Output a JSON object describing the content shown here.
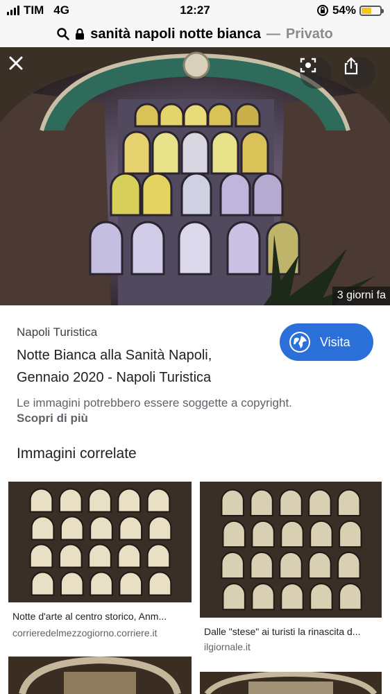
{
  "status_bar": {
    "carrier": "TIM",
    "network": "4G",
    "time": "12:27",
    "battery_percent": "54%",
    "battery_level": 0.54,
    "battery_color": "#f5c518"
  },
  "url_bar": {
    "query": "sanità napoli notte bianca",
    "separator": "—",
    "mode": "Privato"
  },
  "hero": {
    "age_badge": "3 giorni fa"
  },
  "result": {
    "source": "Napoli Turistica",
    "title": "Notte Bianca alla Sanità Napoli, Gennaio 2020 - Napoli Turistica",
    "visit_label": "Visita",
    "copyright_notice": "Le immagini potrebbero essere soggette a copyright.",
    "learn_more": "Scopri di più"
  },
  "related": {
    "heading": "Immagini correlate",
    "items": [
      {
        "caption": "Notte d'arte al centro storico, Anm...",
        "domain": "corrieredelmezzogiorno.corriere.it"
      },
      {
        "caption": "Dalle \"stese\" ai turisti la rinascita d...",
        "domain": "ilgiornale.it"
      }
    ]
  },
  "colors": {
    "accent": "#2b6fd8",
    "bar_bg": "#f7f7f7"
  },
  "icons": [
    "close-icon",
    "lens-icon",
    "share-icon",
    "globe-icon",
    "search-icon",
    "lock-icon",
    "orientation-lock-icon"
  ]
}
